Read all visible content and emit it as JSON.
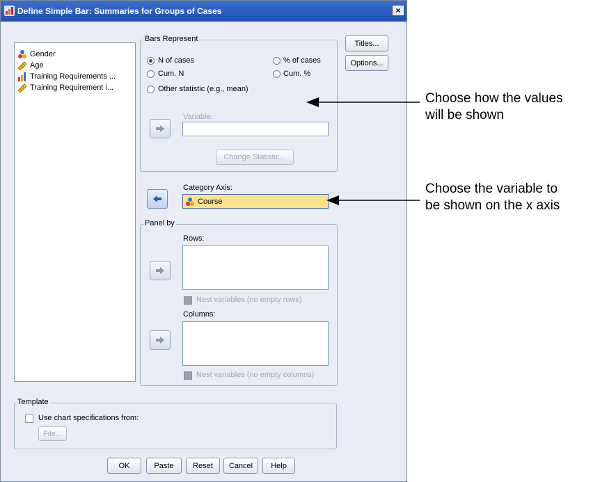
{
  "dialog": {
    "title": "Define Simple Bar: Summaries for Groups of Cases",
    "close_label": "×"
  },
  "variables": [
    {
      "label": "Gender",
      "icon": "nominal-icon"
    },
    {
      "label": "Age",
      "icon": "scale-icon"
    },
    {
      "label": "Training Requirements ...",
      "icon": "ordinal-icon"
    },
    {
      "label": "Training Requirement i...",
      "icon": "scale-icon"
    }
  ],
  "bars_represent": {
    "legend": "Bars Represent",
    "options": {
      "n_of_cases": "N of cases",
      "pct_of_cases": "% of cases",
      "cum_n": "Cum. N",
      "cum_pct": "Cum. %",
      "other_statistic": "Other statistic (e.g., mean)"
    },
    "selected": "N of cases",
    "variable_label": "Variable:",
    "change_statistic_label": "Change Statistic..."
  },
  "category_axis": {
    "label": "Category Axis:",
    "value": "Course"
  },
  "panel_by": {
    "legend": "Panel by",
    "rows_label": "Rows:",
    "nest_rows_label": "Nest variables (no empty rows)",
    "columns_label": "Columns:",
    "nest_columns_label": "Nest variables (no empty columns)"
  },
  "template": {
    "legend": "Template",
    "use_chart_spec_label": "Use chart specifications from:",
    "file_label": "File..."
  },
  "side_buttons": {
    "titles": "Titles...",
    "options": "Options..."
  },
  "footer_buttons": {
    "ok": "OK",
    "paste": "Paste",
    "reset": "Reset",
    "cancel": "Cancel",
    "help": "Help"
  },
  "annotations": {
    "values_line1": "Choose how the values",
    "values_line2": "will be shown",
    "xaxis_line1": "Choose the variable to",
    "xaxis_line2": "be shown on the x axis"
  },
  "colors": {
    "titlebar": "#2a5cc4",
    "category_field": "#fbe38a",
    "dialog_bg": "#e9ecf4"
  }
}
